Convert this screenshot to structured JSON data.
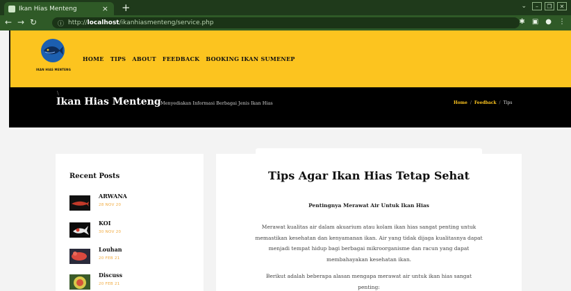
{
  "browser": {
    "tab_title": "Ikan Hias Menteng",
    "tab_close": "×",
    "new_tab": "+",
    "url_prefix": "http://",
    "url_host": "localhost",
    "url_path": "/ikanhiasmenteng/service.php"
  },
  "header": {
    "logo_text": "IKAN HIAS MENTENG",
    "nav": [
      "HOME",
      "TIPS",
      "ABOUT",
      "FEEDBACK",
      "BOOKING IKAN SUMENEP"
    ]
  },
  "title_strip": {
    "site_name": "Ikan Hias Menteng",
    "tagline": "Menyediakan Informasi Berbagai Jenis Ikan Hias",
    "breadcrumb": {
      "home": "Home",
      "feedback": "Feedback",
      "current": "Tips",
      "separator": "/"
    }
  },
  "sidebar": {
    "title": "Recent Posts",
    "posts": [
      {
        "title": "ARWANA",
        "date": "28 NOV 20"
      },
      {
        "title": "KOI",
        "date": "30 NOV 20"
      },
      {
        "title": "Louhan",
        "date": "20 FEB 21"
      },
      {
        "title": "Discuss",
        "date": "20 FEB 21"
      }
    ]
  },
  "article": {
    "title": "Tips Agar Ikan Hias Tetap Sehat",
    "subtitle": "Pentingnya Merawat Air Untuk Ikan Hias",
    "paragraph1": "Merawat kualitas air dalam akuarium atau kolam ikan hias sangat penting untuk memastikan kesehatan dan kenyamanan ikan. Air yang tidak dijaga kualitasnya dapat menjadi tempat hidup bagi berbagai mikroorganisme dan racun yang dapat membahayakan kesehatan ikan.",
    "paragraph2": "Berikut adalah beberapa alasan mengapa merawat air untuk ikan hias sangat penting:"
  },
  "colors": {
    "header_yellow": "#fcc41f",
    "browser_green": "#2f5a27",
    "date_orange": "#f0a93c"
  }
}
